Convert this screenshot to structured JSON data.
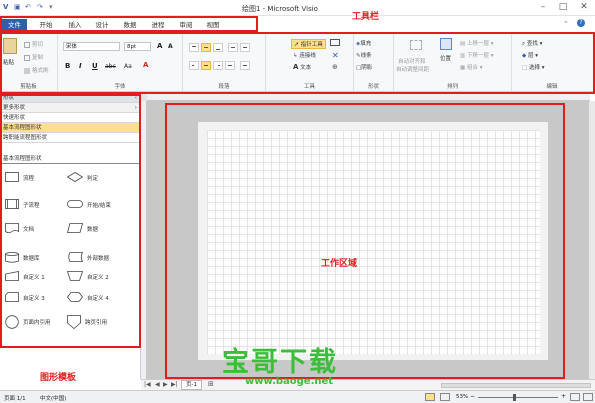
{
  "titlebar": {
    "title": "绘图1 - Microsoft Visio",
    "qat": [
      "visio-logo-icon",
      "save-icon",
      "undo-icon",
      "redo-icon"
    ]
  },
  "tabs": [
    "文件",
    "开始",
    "插入",
    "设计",
    "数据",
    "进程",
    "审阅",
    "视图"
  ],
  "ribbon": {
    "clipboard": {
      "paste": "粘贴",
      "cut": "剪切",
      "copy": "复制",
      "format_painter": "格式刷",
      "label": "剪贴板"
    },
    "font": {
      "name": "宋体",
      "size": "8pt",
      "grow": "A",
      "shrink": "A",
      "bold": "B",
      "italic": "I",
      "underline": "U",
      "strike": "abc",
      "caps": "Aa",
      "color": "A",
      "label": "字体"
    },
    "paragraph": {
      "label": "段落"
    },
    "tools": {
      "pointer": "指针工具",
      "connector": "连接线",
      "text": "文本",
      "label": "工具"
    },
    "shape": {
      "fill": "填充",
      "line": "线条",
      "shadow": "阴影",
      "label": "形状"
    },
    "arrange": {
      "auto_align": "自动对齐和",
      "auto_space": "自动调整间距",
      "position": "位置",
      "bring_forward": "上移一层",
      "send_backward": "下移一层",
      "group": "组合",
      "label": "排列"
    },
    "editing": {
      "find": "查找",
      "layers": "层",
      "select": "选择",
      "label": "编辑"
    }
  },
  "shapes_pane": {
    "header": "形状",
    "sections": [
      "更多形状",
      "快速形状",
      "基本流程图形状",
      "跨职能流程图形状"
    ],
    "active_section": "基本流程图形状",
    "stencil_title": "基本流程图形状",
    "items": [
      "流程",
      "判定",
      "子流程",
      "开始/结束",
      "文档",
      "数据",
      "数据库",
      "外部数据",
      "自定义 1",
      "自定义 2",
      "自定义 3",
      "自定义 4",
      "页面内引用",
      "跨页引用"
    ]
  },
  "page_tab": "页-1",
  "status": {
    "page": "页面 1/1",
    "language": "中文(中国)",
    "zoom": "53%"
  },
  "annotations": {
    "toolbar": "工具栏",
    "workarea": "工作区域",
    "stencil": "图形模板"
  },
  "watermark": {
    "main": "宝哥下载",
    "url": "www.baoge.net"
  },
  "colors": {
    "accent": "#2e5fa8",
    "annotation": "#e21d1d",
    "active_section": "#fde08a",
    "watermark": "#3bbf3b"
  }
}
